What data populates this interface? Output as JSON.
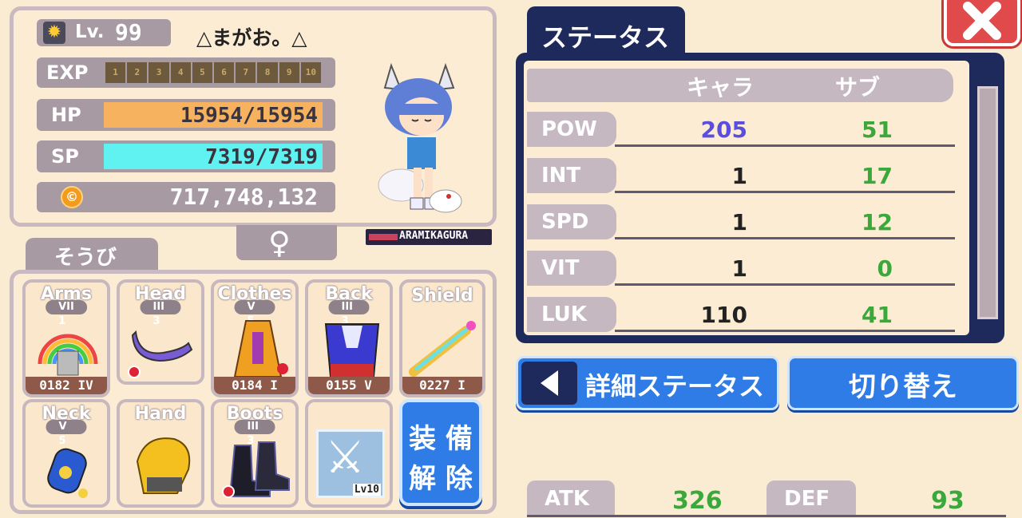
{
  "character": {
    "level_label": "Lv.",
    "level": "99",
    "name": "△まがお。△",
    "exp_label": "EXP",
    "exp_segments": [
      "1",
      "2",
      "3",
      "4",
      "5",
      "6",
      "7",
      "8",
      "9",
      "10"
    ],
    "hp_label": "HP",
    "hp_value": "15954/15954",
    "hp_fraction": 1.0,
    "sp_label": "SP",
    "sp_value": "7319/7319",
    "sp_fraction": 1.0,
    "coins": "717,748,132",
    "gender_symbol": "♀",
    "nameplate": "ARAMIKAGURA"
  },
  "equipment": {
    "tab_label": "そうび",
    "slots": [
      {
        "label": "Arms",
        "rank": "VII",
        "rank_small": "1",
        "count": "0182 IV"
      },
      {
        "label": "Head",
        "rank": "III",
        "rank_small": "3",
        "count": ""
      },
      {
        "label": "Clothes",
        "rank": "V",
        "rank_small": "5",
        "count": "0184 I"
      },
      {
        "label": "Back",
        "rank": "III",
        "rank_small": "3",
        "count": "0155 V"
      },
      {
        "label": "Shield",
        "rank": "",
        "rank_small": "",
        "count": "0227 I"
      },
      {
        "label": "Neck",
        "rank": "V",
        "rank_small": "5",
        "count": ""
      },
      {
        "label": "Hand",
        "rank": "",
        "rank_small": "",
        "count": ""
      },
      {
        "label": "Boots",
        "rank": "III",
        "rank_small": "3",
        "count": ""
      }
    ],
    "skill_level": "Lv10",
    "unequip_label_1": "装 備",
    "unequip_label_2": "解 除"
  },
  "status": {
    "tab_label": "ステータス",
    "col_chara": "キャラ",
    "col_sub": "サブ",
    "rows": [
      {
        "stat": "POW",
        "chara": "205",
        "sub": "51"
      },
      {
        "stat": "INT",
        "chara": "1",
        "sub": "17"
      },
      {
        "stat": "SPD",
        "chara": "1",
        "sub": "12"
      },
      {
        "stat": "VIT",
        "chara": "1",
        "sub": "0"
      },
      {
        "stat": "LUK",
        "chara": "110",
        "sub": "41"
      }
    ],
    "detail_button": "詳細ステータス",
    "switch_button": "切り替え",
    "atk_label": "ATK",
    "atk_value": "326",
    "def_label": "DEF",
    "def_value": "93"
  },
  "colors": {
    "background": "#faecd3",
    "panel_border": "#c9b9c0",
    "hp_bar": "#f6b25e",
    "sp_bar": "#5ff2f0",
    "pow_chara": "#5a4de0",
    "sub_value": "#3aa83a",
    "button_blue": "#3b7ee0",
    "navy": "#202a5e",
    "close_red": "#e04a4a"
  }
}
